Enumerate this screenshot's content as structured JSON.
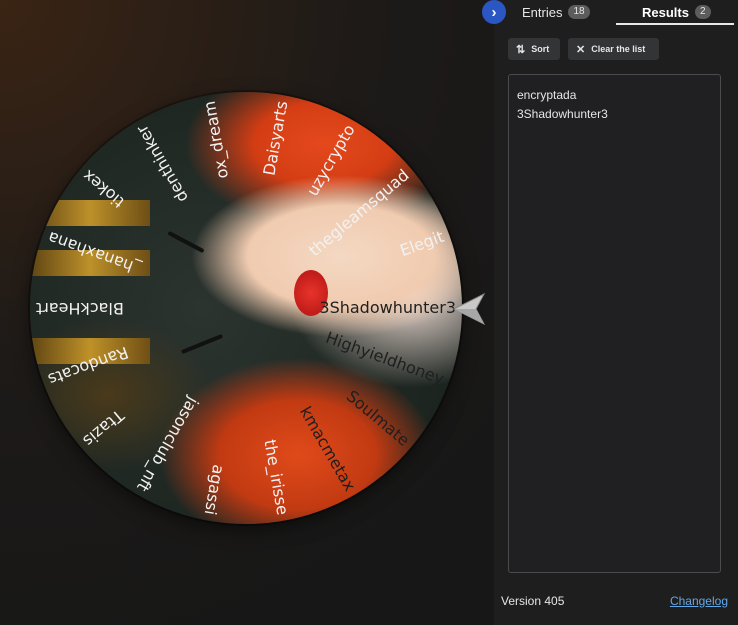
{
  "wheel": {
    "entries": [
      "3Shadowhunter3",
      "Highyieldhoney",
      "Soulmate",
      "kmacmetax",
      "the_irisse",
      "agassi",
      "jasonclub_nft",
      "Ttazis",
      "Randocats",
      "BlackHeart",
      "_hanaxhana",
      "tiokex",
      "denthinker",
      "ox_dream",
      "Daisyarts",
      "uzycrypto",
      "thegleamsquad",
      "Elegit"
    ]
  },
  "panel": {
    "tabs": [
      {
        "label": "Entries",
        "count": "18"
      },
      {
        "label": "Results",
        "count": "2"
      }
    ],
    "sort_label": "Sort",
    "clear_label": "Clear the list",
    "results": [
      "encryptada",
      "3Shadowhunter3"
    ],
    "version": "Version 405",
    "changelog": "Changelog"
  },
  "icons": {
    "collapse": "chevron-right-icon",
    "sort": "sort-icon",
    "clear": "close-icon",
    "pointer": "pointer-arrow-icon"
  },
  "colors": {
    "accent": "#2a57c4",
    "link": "#62a8e6",
    "panel_bg": "#1e1e1f"
  }
}
